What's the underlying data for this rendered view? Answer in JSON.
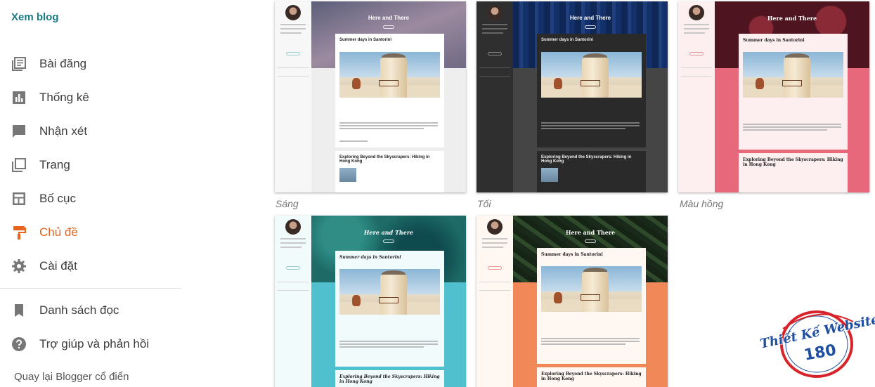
{
  "sidebar": {
    "view_blog": "Xem blog",
    "items": [
      {
        "label": "Bài đăng",
        "icon": "posts-icon"
      },
      {
        "label": "Thống kê",
        "icon": "stats-icon"
      },
      {
        "label": "Nhận xét",
        "icon": "comments-icon"
      },
      {
        "label": "Trang",
        "icon": "pages-icon"
      },
      {
        "label": "Bố cục",
        "icon": "layout-icon"
      },
      {
        "label": "Chủ đề",
        "icon": "theme-paint-roller-icon",
        "active": true
      },
      {
        "label": "Cài đặt",
        "icon": "settings-gear-icon"
      }
    ],
    "secondary": [
      {
        "label": "Danh sách đọc",
        "icon": "bookmark-icon"
      },
      {
        "label": "Trợ giúp và phản hồi",
        "icon": "help-icon"
      }
    ],
    "classic_link": "Quay lại Blogger cổ điển"
  },
  "themes": [
    {
      "caption": "Sáng",
      "banner_title": "Here and There",
      "post1_title": "Summer days in Santorini",
      "post2_title": "Exploring Beyond the Skyscrapers: Hiking in Hong Kong",
      "colors": {
        "banner": "#7d7a8c",
        "lower": "#eeeeee",
        "card": "#ffffff",
        "side": "#f7f7f7"
      }
    },
    {
      "caption": "Tối",
      "banner_title": "Here and There",
      "post1_title": "Summer days in Santorini",
      "post2_title": "Exploring Beyond the Skyscrapers: Hiking in Hong Kong",
      "colors": {
        "banner": "#1a3566",
        "lower": "#454545",
        "card": "#2a2a2a",
        "side": "#2f2f2f"
      }
    },
    {
      "caption": "Màu hồng",
      "banner_title": "Here and There",
      "post1_title": "Summer days in Santorini",
      "post2_title": "Exploring Beyond the Skyscrapers: Hiking in Hong Kong",
      "colors": {
        "banner": "#5a1a22",
        "lower": "#e7687a",
        "card": "#fdeef0",
        "side": "#fdeef0"
      }
    },
    {
      "caption": "",
      "banner_title": "Here and There",
      "post1_title": "Summer days in Santorini",
      "post2_title": "Exploring Beyond the Skyscrapers: Hiking in Hong Kong",
      "colors": {
        "banner": "#1f6a66",
        "lower": "#50c0cf",
        "card": "#f2fbfc",
        "side": "#f2fbfc"
      }
    },
    {
      "caption": "",
      "banner_title": "Here and There",
      "post1_title": "Summer days in Santorini",
      "post2_title": "Exploring Beyond the Skyscrapers: Hiking in Hong Kong",
      "colors": {
        "banner": "#20301f",
        "lower": "#f08858",
        "card": "#fff7f2",
        "side": "#fff7f2"
      }
    }
  ],
  "logo": {
    "line1": "Thiết Kế Website",
    "line2": "180",
    "colors": {
      "red": "#d8232a",
      "blue": "#1f4fa0"
    }
  }
}
